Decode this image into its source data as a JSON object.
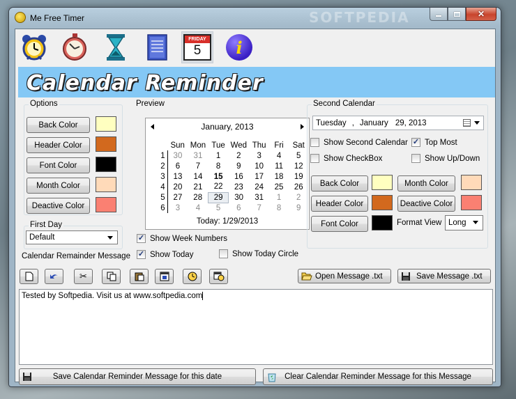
{
  "window": {
    "title": "Me Free Timer",
    "watermark": "SOFTPEDIA"
  },
  "toolbar": {
    "icons": [
      "alarm-clock-icon",
      "stopwatch-icon",
      "hourglass-icon",
      "notepad-icon",
      "calendar-page-icon",
      "info-icon"
    ],
    "calendar_page_day": "FRIDAY",
    "calendar_page_num": "5",
    "info_glyph": "i"
  },
  "banner": {
    "title": "Calendar Reminder"
  },
  "options": {
    "label": "Options",
    "back_color": "Back Color",
    "header_color": "Header Color",
    "font_color": "Font Color",
    "month_color": "Month Color",
    "deactive_color": "Deactive Color",
    "swatches": {
      "back": "#ffffc0",
      "header": "#d2691e",
      "font": "#000000",
      "month": "#ffdab9",
      "deactive": "#fa8072"
    }
  },
  "first_day": {
    "label": "First Day",
    "value": "Default"
  },
  "preview": {
    "label": "Preview",
    "month_title": "January, 2013",
    "weekdays": [
      "Sun",
      "Mon",
      "Tue",
      "Wed",
      "Thu",
      "Fri",
      "Sat"
    ],
    "weeks": [
      {
        "num": "1",
        "days": [
          "30",
          "31",
          "1",
          "2",
          "3",
          "4",
          "5"
        ]
      },
      {
        "num": "2",
        "days": [
          "6",
          "7",
          "8",
          "9",
          "10",
          "11",
          "12"
        ]
      },
      {
        "num": "3",
        "days": [
          "13",
          "14",
          "15",
          "16",
          "17",
          "18",
          "19"
        ]
      },
      {
        "num": "4",
        "days": [
          "20",
          "21",
          "22",
          "23",
          "24",
          "25",
          "26"
        ]
      },
      {
        "num": "5",
        "days": [
          "27",
          "28",
          "29",
          "30",
          "31",
          "1",
          "2"
        ]
      },
      {
        "num": "6",
        "days": [
          "3",
          "4",
          "5",
          "6",
          "7",
          "8",
          "9"
        ]
      }
    ],
    "today_line": "Today: 1/29/2013"
  },
  "preview_options": {
    "show_week_numbers": "Show Week Numbers",
    "show_today": "Show Today",
    "show_today_circle": "Show Today Circle"
  },
  "second_calendar": {
    "label": "Second Calendar",
    "date_weekday": "Tuesday",
    "date_sep": ",",
    "date_month": "January",
    "date_rest": "29, 2013",
    "show_second_calendar": "Show Second Calendar",
    "top_most": "Top Most",
    "show_checkbox": "Show CheckBox",
    "show_up_down": "Show Up/Down",
    "back_color": "Back Color",
    "month_color": "Month Color",
    "header_color": "Header Color",
    "deactive_color": "Deactive Color",
    "font_color": "Font Color",
    "format_view_label": "Format View",
    "format_view_value": "Long",
    "swatches": {
      "back": "#ffffc0",
      "month": "#ffdab9",
      "header": "#d2691e",
      "deactive": "#fa8072",
      "font": "#000000"
    }
  },
  "message": {
    "label": "Calendar Remainder Message",
    "open_button": "Open Message .txt",
    "save_button": "Save Message .txt",
    "text": "Tested by Softpedia. Visit us at www.softpedia.com",
    "save_reminder_button": "Save Calendar Reminder Message for this date",
    "clear_reminder_button": "Clear Calendar Reminder Message for this Message"
  }
}
